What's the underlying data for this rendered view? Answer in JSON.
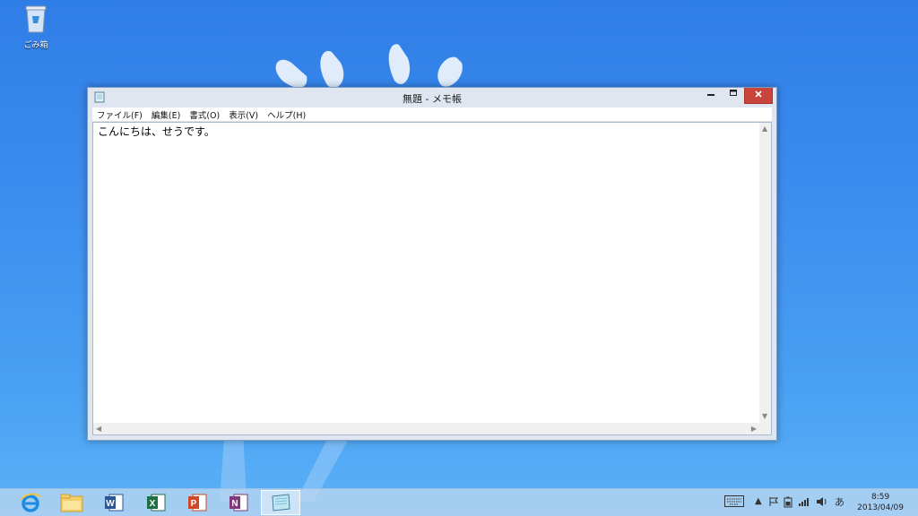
{
  "desktop": {
    "recycle_bin": {
      "label": "ごみ箱",
      "icon": "recycle-bin-icon"
    }
  },
  "window": {
    "title": "無題 - メモ帳",
    "controls": {
      "minimize": "minimize",
      "maximize": "maximize",
      "close": "close"
    },
    "menu": [
      {
        "label": "ファイル(F)"
      },
      {
        "label": "編集(E)"
      },
      {
        "label": "書式(O)"
      },
      {
        "label": "表示(V)"
      },
      {
        "label": "ヘルプ(H)"
      }
    ],
    "content": "こんにちは、せうです。"
  },
  "taskbar": {
    "apps": [
      {
        "name": "internet-explorer",
        "icon": "ie-icon"
      },
      {
        "name": "file-explorer",
        "icon": "folder-icon"
      },
      {
        "name": "word",
        "icon": "word-icon"
      },
      {
        "name": "excel",
        "icon": "excel-icon"
      },
      {
        "name": "powerpoint",
        "icon": "powerpoint-icon"
      },
      {
        "name": "onenote",
        "icon": "onenote-icon"
      },
      {
        "name": "notepad",
        "icon": "notepad-icon",
        "active": true
      }
    ],
    "tray": {
      "ime_mode": "あ",
      "time": "8:59",
      "date": "2013/04/09"
    }
  },
  "colors": {
    "desktop_bg": "#3b8cee",
    "close_button": "#c9443a",
    "window_frame": "#dfe6ef"
  }
}
